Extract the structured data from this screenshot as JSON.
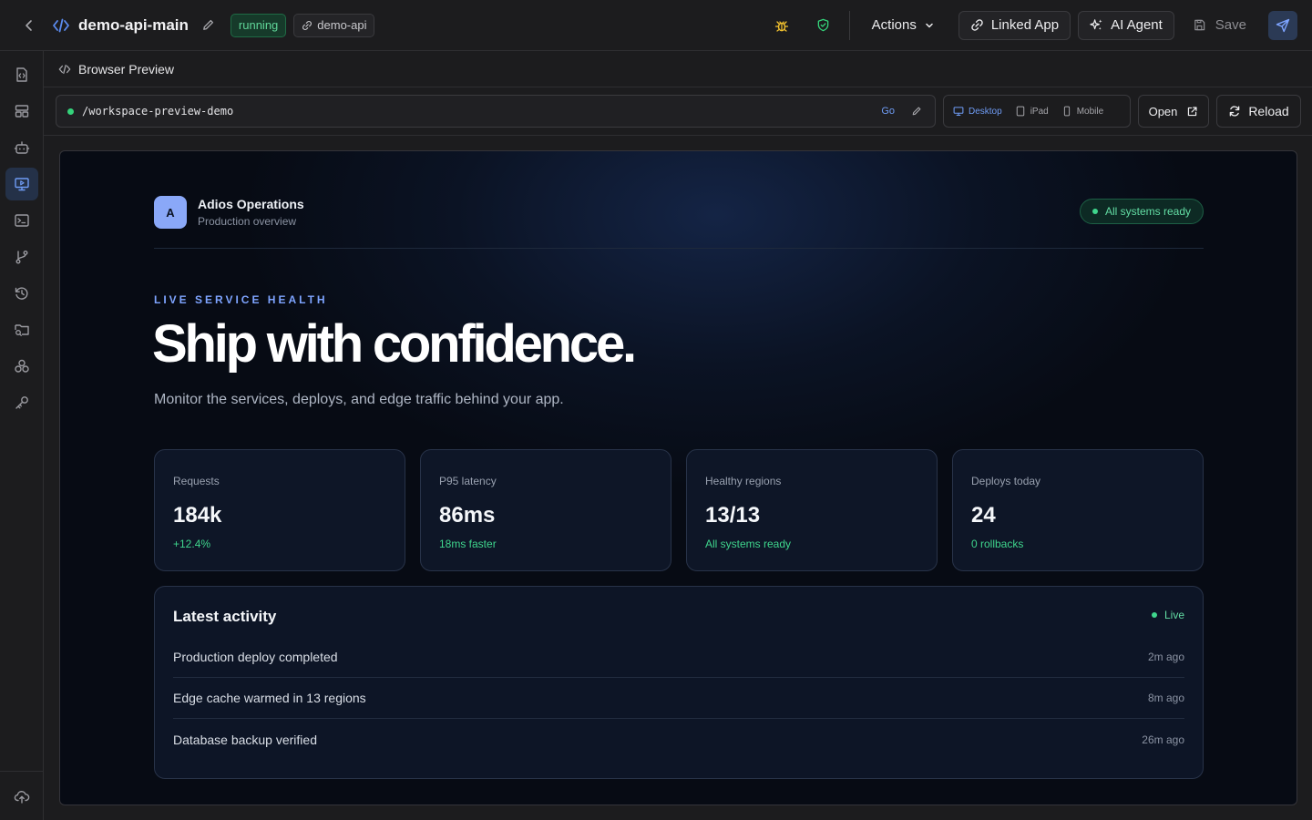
{
  "topbar": {
    "project_title": "demo-api-main",
    "status_badge": "running",
    "linked_repo": "demo-api",
    "actions_label": "Actions",
    "linked_app_label": "Linked App",
    "ai_agent_label": "AI Agent",
    "save_label": "Save",
    "icons": [
      "chevron-left-icon",
      "code-icon",
      "pencil-icon",
      "bug-icon",
      "shield-check-icon",
      "chevron-down-icon",
      "link-icon",
      "sparkles-icon",
      "floppy-icon",
      "send-icon"
    ]
  },
  "sidebar": {
    "items": [
      {
        "icon": "file-code-icon",
        "active": false
      },
      {
        "icon": "layout-icon",
        "active": false
      },
      {
        "icon": "bot-icon",
        "active": false
      },
      {
        "icon": "monitor-play-icon",
        "active": true
      },
      {
        "icon": "terminal-icon",
        "active": false
      },
      {
        "icon": "git-branch-icon",
        "active": false
      },
      {
        "icon": "history-icon",
        "active": false
      },
      {
        "icon": "folder-search-icon",
        "active": false
      },
      {
        "icon": "boxes-icon",
        "active": false
      },
      {
        "icon": "key-icon",
        "active": false
      }
    ],
    "bottom_icon": "cloud-upload-icon"
  },
  "panel": {
    "title": "Browser Preview",
    "url": "/workspace-preview-demo",
    "go_label": "Go",
    "devices": [
      {
        "label": "Desktop",
        "active": true
      },
      {
        "label": "iPad",
        "active": false
      },
      {
        "label": "Mobile",
        "active": false
      }
    ],
    "open_label": "Open",
    "reload_label": "Reload"
  },
  "preview": {
    "logo_letter": "A",
    "brand_name": "Adios Operations",
    "brand_sub": "Production overview",
    "status": "All systems ready",
    "eyebrow": "LIVE SERVICE HEALTH",
    "headline": "Ship with confidence.",
    "subheadline": "Monitor the services, deploys, and edge traffic behind your app.",
    "stats": [
      {
        "label": "Requests",
        "value": "184k",
        "delta": "+12.4%"
      },
      {
        "label": "P95 latency",
        "value": "86ms",
        "delta": "18ms faster"
      },
      {
        "label": "Healthy regions",
        "value": "13/13",
        "delta": "All systems ready"
      },
      {
        "label": "Deploys today",
        "value": "24",
        "delta": "0 rollbacks"
      }
    ],
    "activity": {
      "title": "Latest activity",
      "live_label": "Live",
      "items": [
        {
          "text": "Production deploy completed",
          "time": "2m ago"
        },
        {
          "text": "Edge cache warmed in 13 regions",
          "time": "8m ago"
        },
        {
          "text": "Database backup verified",
          "time": "26m ago"
        }
      ]
    }
  },
  "colors": {
    "accent_blue": "#6f9cf5",
    "success_green": "#3fd68d",
    "warning_amber": "#f2c12e"
  }
}
